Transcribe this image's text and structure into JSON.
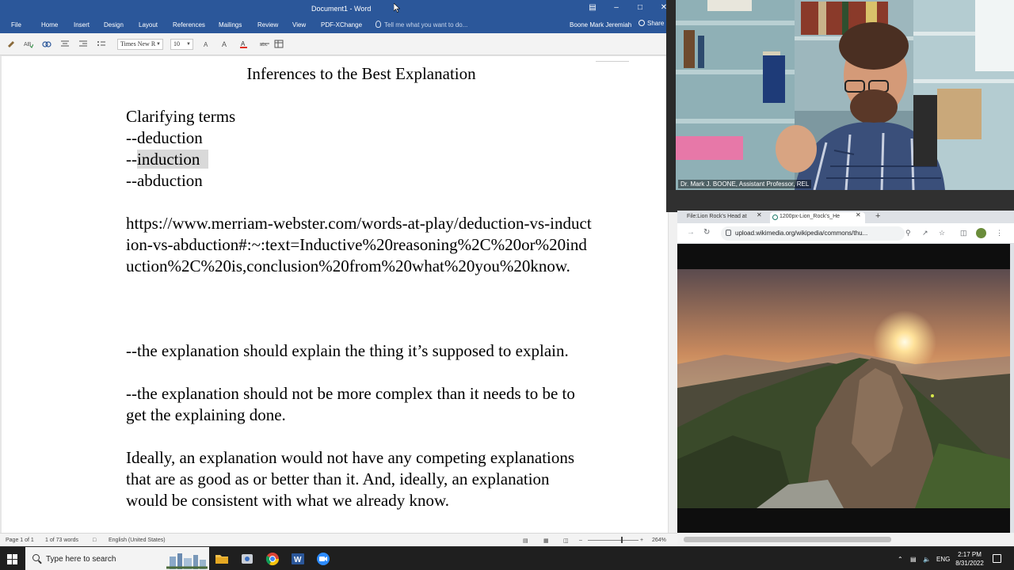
{
  "word": {
    "window_title": "Document1 - Word",
    "tabs": [
      "File",
      "Home",
      "Insert",
      "Design",
      "Layout",
      "References",
      "Mailings",
      "Review",
      "View",
      "PDF-XChange"
    ],
    "tell_me_placeholder": "Tell me what you want to do...",
    "user_name": "Boone Mark Jeremiah",
    "share_label": "Share",
    "font_name": "Times New R",
    "font_size": "10",
    "document": {
      "title": "Inferences to the Best Explanation",
      "clarifying_heading": "Clarifying terms",
      "term_deduction": "--deduction",
      "term_induction_prefix": "--",
      "term_induction": "induction",
      "term_abduction": "--abduction",
      "url_paragraph": "https://www.merriam-webster.com/words-at-play/deduction-vs-induction-vs-abduction#:~:text=Inductive%20reasoning%2C%20or%20induction%2C%20is,conclusion%20from%20what%20you%20know.",
      "criteria_1": "--the explanation should explain the thing it’s supposed to explain.",
      "criteria_2": "--the explanation should not be more complex than it needs to be to get the explaining done.",
      "ideally_paragraph": "Ideally, an explanation would not have any competing explanations that are as good as or better than it. And, ideally, an explanation would be consistent with what we already know."
    },
    "status": {
      "page": "Page 1 of 1",
      "words": "1 of 73 words",
      "language": "English (United States)",
      "zoom": "264%"
    }
  },
  "webcam": {
    "caption": "Dr. Mark J. BOONE, Assistant Professor, REL"
  },
  "browser": {
    "tabs": [
      {
        "label": "File:Lion Rock's Head at"
      },
      {
        "label": "1200px-Lion_Rock's_He"
      }
    ],
    "address": "upload.wikimedia.org/wikipedia/commons/thu..."
  },
  "taskbar": {
    "search_placeholder": "Type here to search",
    "language": "ENG",
    "time": "2:17 PM",
    "date": "8/31/2022"
  },
  "colors": {
    "word_blue": "#2b579a",
    "highlight": "#d9d9d9",
    "taskbar": "#1f1f1f"
  }
}
